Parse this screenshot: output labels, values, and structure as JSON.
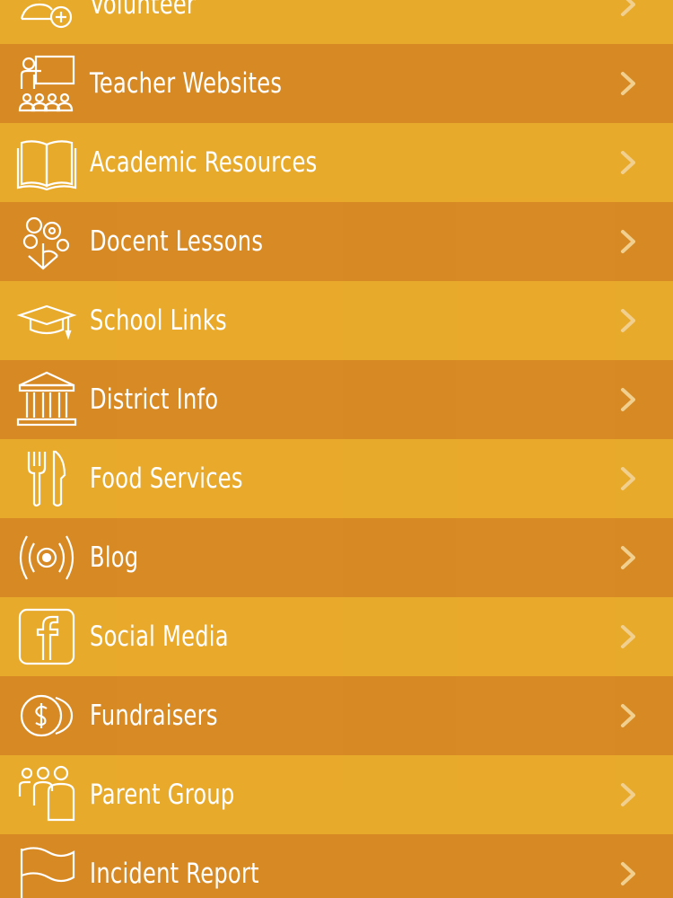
{
  "menu": {
    "items": [
      {
        "label": "Volunteer",
        "icon": "volunteer-icon"
      },
      {
        "label": "Teacher Websites",
        "icon": "teacher-icon"
      },
      {
        "label": "Academic Resources",
        "icon": "book-icon"
      },
      {
        "label": "Docent Lessons",
        "icon": "flower-icon"
      },
      {
        "label": "School Links",
        "icon": "graduation-cap-icon"
      },
      {
        "label": "District Info",
        "icon": "building-icon"
      },
      {
        "label": "Food Services",
        "icon": "fork-knife-icon"
      },
      {
        "label": "Blog",
        "icon": "broadcast-icon"
      },
      {
        "label": "Social Media",
        "icon": "facebook-icon"
      },
      {
        "label": "Fundraisers",
        "icon": "coins-icon"
      },
      {
        "label": "Parent Group",
        "icon": "group-icon"
      },
      {
        "label": "Incident Report",
        "icon": "flag-icon"
      }
    ]
  },
  "colors": {
    "row_light": "#e8aa2c",
    "row_dark": "#d68824",
    "text": "#ffffff",
    "chevron": "#f1cf8e"
  }
}
